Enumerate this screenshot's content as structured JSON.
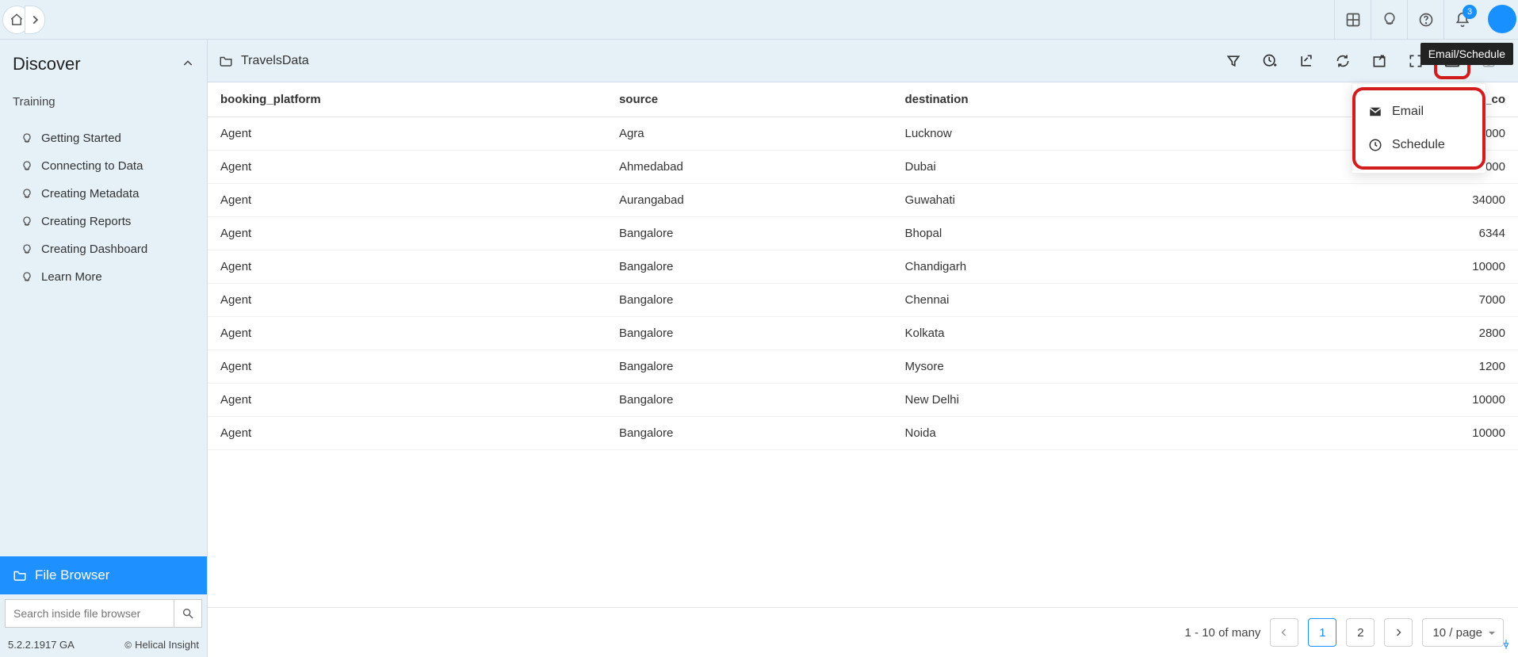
{
  "header": {
    "notification_count": "3"
  },
  "tooltip": "Email/Schedule",
  "sidebar": {
    "title": "Discover",
    "section": "Training",
    "items": [
      {
        "label": "Getting Started"
      },
      {
        "label": "Connecting to Data"
      },
      {
        "label": "Creating Metadata"
      },
      {
        "label": "Creating Reports"
      },
      {
        "label": "Creating Dashboard"
      },
      {
        "label": "Learn More"
      }
    ],
    "file_browser": "File Browser",
    "search_placeholder": "Search inside file browser",
    "version": "5.2.2.1917 GA",
    "copyright": "Helical Insight"
  },
  "breadcrumb": {
    "label": "TravelsData"
  },
  "dropdown": {
    "email": "Email",
    "schedule": "Schedule"
  },
  "table": {
    "columns": [
      {
        "key": "booking_platform",
        "label": "booking_platform"
      },
      {
        "key": "source",
        "label": "source"
      },
      {
        "key": "destination",
        "label": "destination"
      },
      {
        "key": "sum_travel_cost",
        "label": "sum_travel_co",
        "numeric": true
      }
    ],
    "rows": [
      {
        "booking_platform": "Agent",
        "source": "Agra",
        "destination": "Lucknow",
        "sum_travel_cost": "000"
      },
      {
        "booking_platform": "Agent",
        "source": "Ahmedabad",
        "destination": "Dubai",
        "sum_travel_cost": "000"
      },
      {
        "booking_platform": "Agent",
        "source": "Aurangabad",
        "destination": "Guwahati",
        "sum_travel_cost": "34000"
      },
      {
        "booking_platform": "Agent",
        "source": "Bangalore",
        "destination": "Bhopal",
        "sum_travel_cost": "6344"
      },
      {
        "booking_platform": "Agent",
        "source": "Bangalore",
        "destination": "Chandigarh",
        "sum_travel_cost": "10000"
      },
      {
        "booking_platform": "Agent",
        "source": "Bangalore",
        "destination": "Chennai",
        "sum_travel_cost": "7000"
      },
      {
        "booking_platform": "Agent",
        "source": "Bangalore",
        "destination": "Kolkata",
        "sum_travel_cost": "2800"
      },
      {
        "booking_platform": "Agent",
        "source": "Bangalore",
        "destination": "Mysore",
        "sum_travel_cost": "1200"
      },
      {
        "booking_platform": "Agent",
        "source": "Bangalore",
        "destination": "New Delhi",
        "sum_travel_cost": "10000"
      },
      {
        "booking_platform": "Agent",
        "source": "Bangalore",
        "destination": "Noida",
        "sum_travel_cost": "10000"
      }
    ]
  },
  "pager": {
    "range": "1 - 10 of many",
    "pages": [
      "1",
      "2"
    ],
    "active": "1",
    "size_label": "10 / page"
  }
}
